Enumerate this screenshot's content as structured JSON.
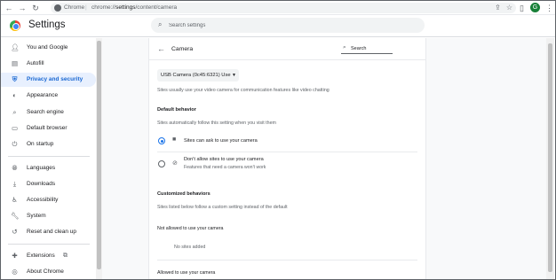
{
  "browser": {
    "back_glyph": "←",
    "forward_glyph": "→",
    "reload_glyph": "↻",
    "brand": "Chrome",
    "separator": "|",
    "url_prefix": "chrome://",
    "url_highlight": "settings",
    "url_suffix": "/content/camera",
    "avatar_letter": "G"
  },
  "header": {
    "title": "Settings",
    "search_placeholder": "Search settings"
  },
  "sidebar": {
    "items": [
      {
        "label": "You and Google",
        "icon": "person-icon"
      },
      {
        "label": "Autofill",
        "icon": "clipboard-icon"
      },
      {
        "label": "Privacy and security",
        "icon": "shield-icon",
        "active": true
      },
      {
        "label": "Appearance",
        "icon": "palette-icon"
      },
      {
        "label": "Search engine",
        "icon": "search-icon"
      },
      {
        "label": "Default browser",
        "icon": "browser-icon"
      },
      {
        "label": "On startup",
        "icon": "power-icon"
      },
      {
        "label": "Languages",
        "icon": "globe-icon"
      },
      {
        "label": "Downloads",
        "icon": "download-icon"
      },
      {
        "label": "Accessibility",
        "icon": "accessibility-icon"
      },
      {
        "label": "System",
        "icon": "wrench-icon"
      },
      {
        "label": "Reset and clean up",
        "icon": "history-icon"
      },
      {
        "label": "Extensions",
        "icon": "puzzle-icon"
      },
      {
        "label": "About Chrome",
        "icon": "chrome-icon"
      }
    ]
  },
  "camera_page": {
    "title": "Camera",
    "search_placeholder": "Search",
    "device_select": "USB Camera (0c45:6321) Use",
    "device_desc": "Sites usually use your video camera for communication features like video chatting",
    "default_behavior_title": "Default behavior",
    "default_behavior_desc": "Sites automatically follow this setting when you visit them",
    "option_allow": "Sites can ask to use your camera",
    "option_block": "Don't allow sites to use your camera",
    "option_block_sub": "Features that need a camera won't work",
    "customized_title": "Customized behaviors",
    "customized_desc": "Sites listed below follow a custom setting instead of the default",
    "not_allowed_title": "Not allowed to use your camera",
    "no_sites": "No sites added",
    "allowed_title": "Allowed to use your camera"
  },
  "colors": {
    "accent": "#1a73e8",
    "active_bg": "#e8f0fe",
    "avatar": "#188038"
  }
}
